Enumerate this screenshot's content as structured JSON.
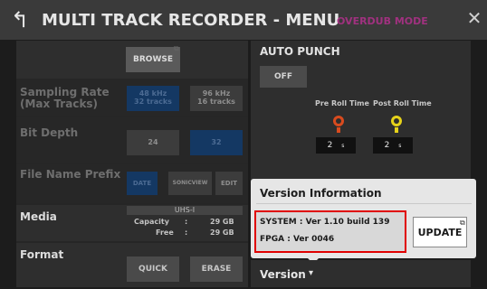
{
  "title": {
    "text": "MULTI TRACK RECORDER - MENU",
    "mode": "OVERDUB MODE"
  },
  "left": {
    "browse": "BROWSE",
    "sampling_rate": {
      "label_line1": "Sampling Rate",
      "label_line2": "(Max Tracks)",
      "opt1": "48 kHz",
      "opt1b": "32 tracks",
      "opt2": "96 kHz",
      "opt2b": "16 tracks"
    },
    "bit_depth": {
      "label": "Bit Depth",
      "opt1": "24",
      "opt2": "32"
    },
    "file_name_prefix": {
      "label": "File Name Prefix",
      "opt1": "DATE",
      "opt2": "SONICVIEW",
      "opt3": "EDIT"
    },
    "media": {
      "label": "Media",
      "type": "UHS-I",
      "capacity_label": "Capacity",
      "capacity_value": "29 GB",
      "free_label": "Free",
      "free_value": "29 GB",
      "colon": ":"
    },
    "format": {
      "label": "Format",
      "quick": "QUICK",
      "erase": "ERASE"
    }
  },
  "right": {
    "auto_punch": "AUTO PUNCH",
    "off": "OFF",
    "pre_roll": "Pre Roll Time",
    "post_roll": "Post Roll Time",
    "pre_value": "2",
    "post_value": "2",
    "unit": "s",
    "pre_knob_color": "#d94b1e",
    "post_knob_color": "#e6d21a"
  },
  "popup": {
    "title": "Version Information",
    "system_line": "SYSTEM : Ver  1.10 build 139",
    "fpga_line": "FPGA    : Ver 0046",
    "update": "UPDATE",
    "highlight_color": "#e00000"
  },
  "version_bar": {
    "label": "Version",
    "arrow": "▾"
  },
  "icons": {
    "back": "↰",
    "close": "✕",
    "external": "⧉"
  }
}
